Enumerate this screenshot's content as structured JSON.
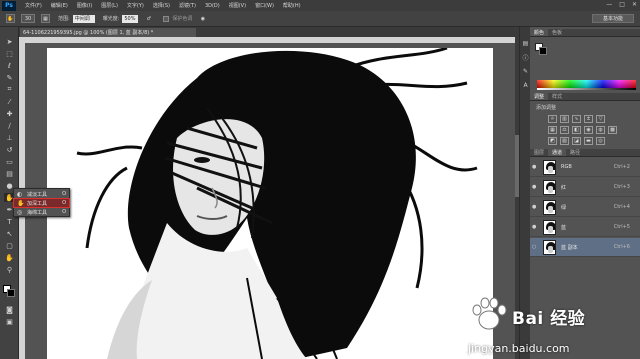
{
  "app": {
    "logo": "Ps",
    "menu": [
      "文件(F)",
      "编辑(E)",
      "图像(I)",
      "图层(L)",
      "文字(Y)",
      "选择(S)",
      "滤镜(T)",
      "3D(D)",
      "视图(V)",
      "窗口(W)",
      "帮助(H)"
    ],
    "window_controls": [
      "—",
      "□",
      "✕"
    ]
  },
  "options_bar": {
    "brush_size": "30",
    "range_label": "范围:",
    "range_value": "中间调",
    "exposure_label": "曝光度:",
    "exposure_value": "50%",
    "protect_label": "保护色调",
    "workspace": "基本功能"
  },
  "document": {
    "tab_title": "64-1106221959395.jpg @ 100% (图层 1, 蓝 副本/8) *"
  },
  "tool_flyout": {
    "items": [
      {
        "icon": "dodge-tool-icon",
        "glyph": "◐",
        "label": "减淡工具",
        "shortcut": "O",
        "active": false
      },
      {
        "icon": "burn-tool-icon",
        "glyph": "✋",
        "label": "加深工具",
        "shortcut": "O",
        "active": true
      },
      {
        "icon": "sponge-tool-icon",
        "glyph": "◎",
        "label": "海绵工具",
        "shortcut": "O",
        "active": false
      }
    ]
  },
  "panels": {
    "color_tabs": [
      "颜色",
      "色板"
    ],
    "adjust_tabs": [
      "调整",
      "样式"
    ],
    "adjust_title": "添加调整",
    "layers_tabs": [
      "图层",
      "通道",
      "路径"
    ],
    "channels": [
      {
        "name": "RGB",
        "shortcut": "Ctrl+2",
        "selected": false
      },
      {
        "name": "红",
        "shortcut": "Ctrl+3",
        "selected": false
      },
      {
        "name": "绿",
        "shortcut": "Ctrl+4",
        "selected": false
      },
      {
        "name": "蓝",
        "shortcut": "Ctrl+5",
        "selected": false
      },
      {
        "name": "蓝 副本",
        "shortcut": "Ctrl+6",
        "selected": true
      }
    ]
  },
  "watermark": {
    "brand": "Bai",
    "brand_suffix": "经验",
    "url": "jingyan.baidu.com"
  },
  "colors": {
    "accent_selected_layer": "#5f6f86",
    "flyout_highlight": "#d93030"
  }
}
